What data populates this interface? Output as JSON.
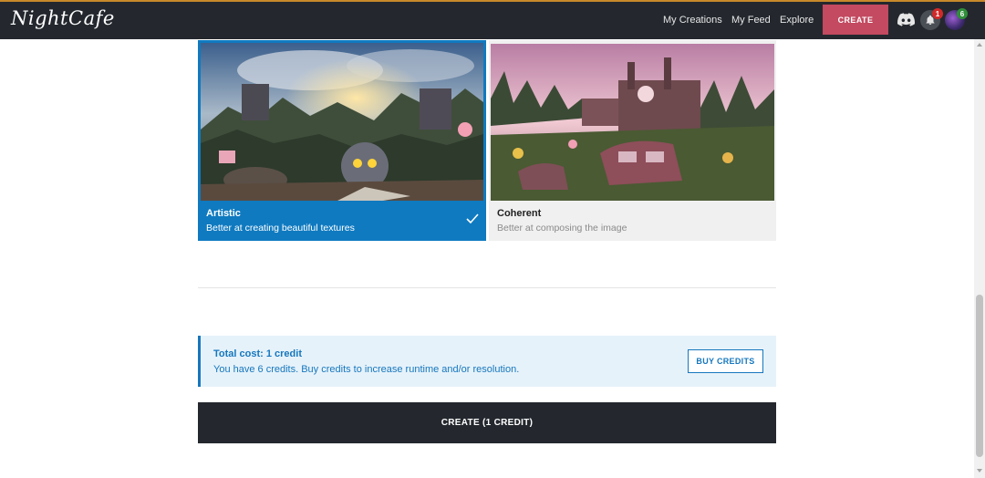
{
  "header": {
    "logo": "NightCafe",
    "nav": [
      "My Creations",
      "My Feed",
      "Explore"
    ],
    "create_label": "CREATE",
    "notification_count": "1",
    "avatar_badge": "6"
  },
  "styles": {
    "options": [
      {
        "title": "Artistic",
        "subtitle": "Better at creating beautiful textures",
        "selected": true
      },
      {
        "title": "Coherent",
        "subtitle": "Better at composing the image",
        "selected": false
      }
    ]
  },
  "cost": {
    "title": "Total cost: 1 credit",
    "description": "You have 6 credits. Buy credits to increase runtime and/or resolution.",
    "buy_label": "BUY CREDITS"
  },
  "main_create_label": "CREATE (1 CREDIT)",
  "colors": {
    "brand_dark": "#24282e",
    "create_accent": "#c34a60",
    "selected_blue": "#0f7ac0",
    "info_blue": "#1677bd"
  }
}
